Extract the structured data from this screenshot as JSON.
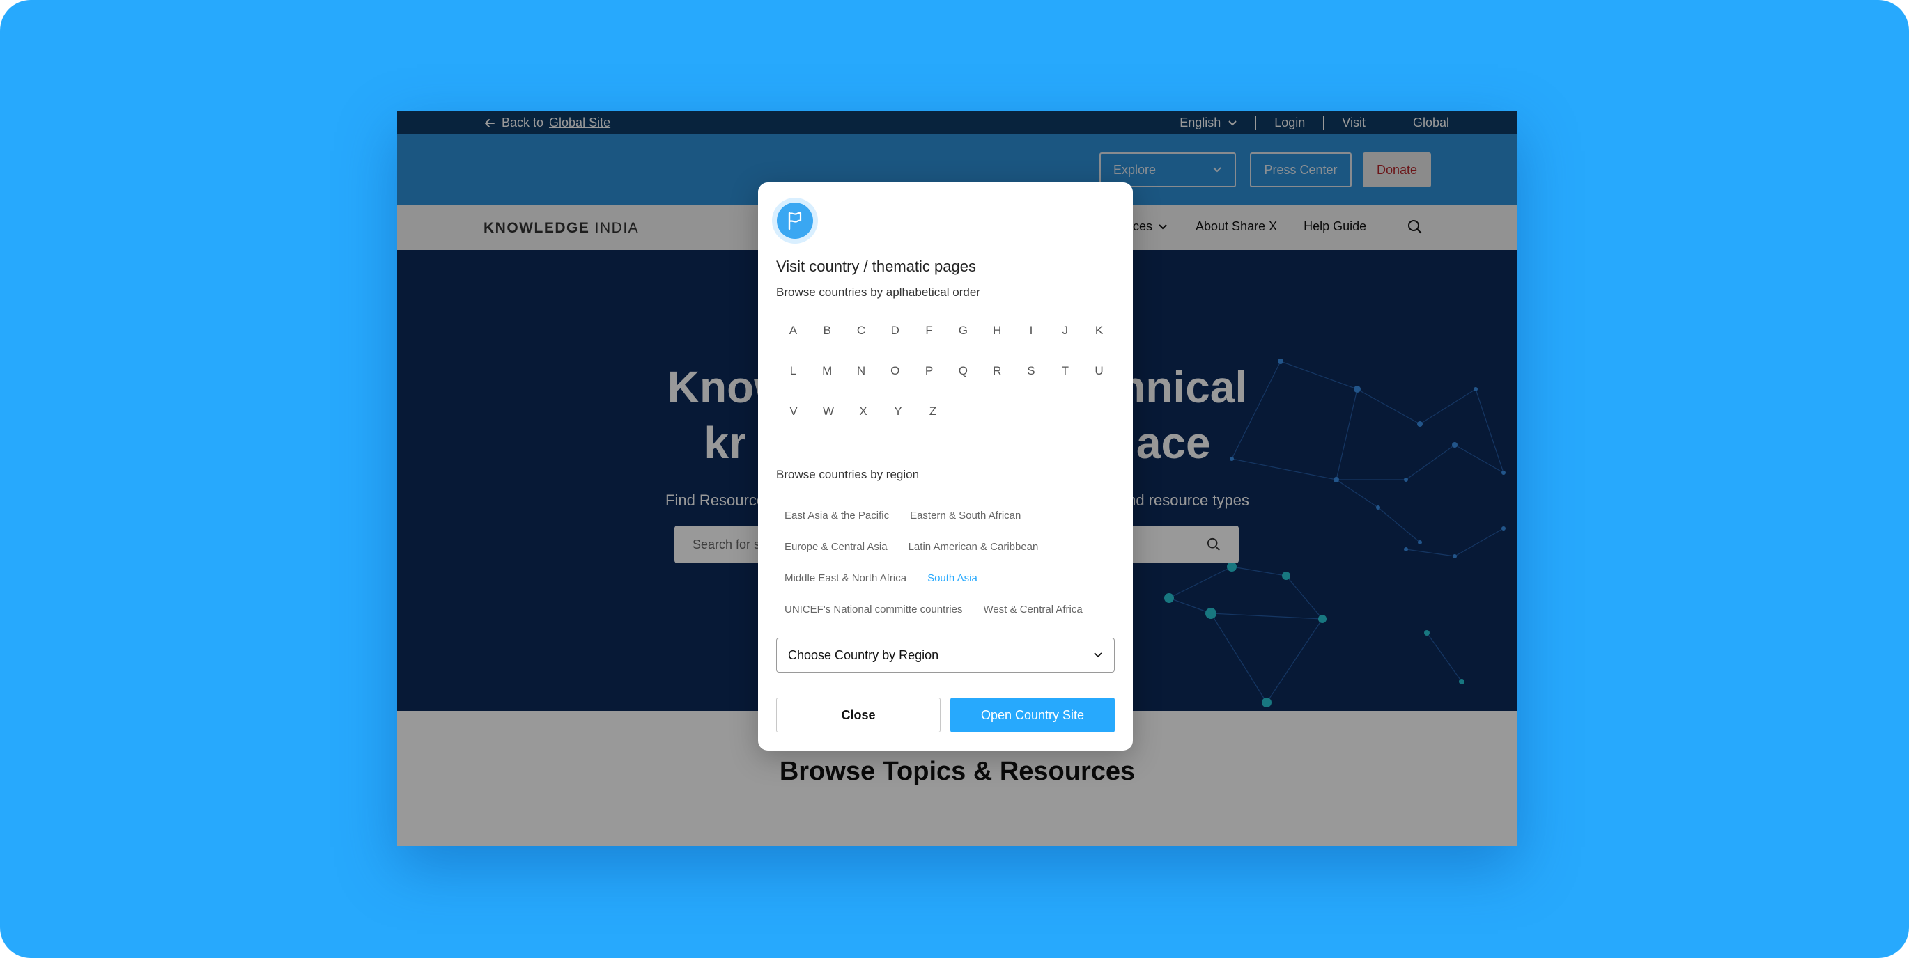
{
  "colors": {
    "frame_background": "#27a9fd",
    "top_bar": "#0e3b66",
    "header_bar": "#2e90d8",
    "hero_background": "#0d2a5b",
    "accent": "#27a9fd",
    "donate_text": "#b3262a"
  },
  "topbar": {
    "back_prefix": "Back to",
    "back_link": "Global Site",
    "language": "English",
    "login": "Login",
    "visit": "Visit",
    "global": "Global"
  },
  "header": {
    "explore_placeholder": "Explore",
    "press_center": "Press Center",
    "donate": "Donate"
  },
  "nav": {
    "brand_bold": "KNOWLEDGE",
    "brand_light": "INDIA",
    "resources_partial": "urces",
    "about": "About Share X",
    "help": "Help Guide"
  },
  "hero": {
    "line1_left": "Knowl",
    "line1_right": "chnical",
    "line2_left": "kr",
    "line2_right": "ace",
    "subtitle_left": "Find Resource",
    "subtitle_right": "nd resource types",
    "search_placeholder_partial": "Search for s"
  },
  "browse": {
    "heading": "Browse Topics & Resources"
  },
  "modal": {
    "icon": "flag-icon",
    "title": "Visit country / thematic pages",
    "alpha_title": "Browse countries by aplhabetical order",
    "letter_rows": [
      [
        "A",
        "B",
        "C",
        "D",
        "F",
        "G",
        "H",
        "I",
        "J",
        "K"
      ],
      [
        "L",
        "M",
        "N",
        "O",
        "P",
        "Q",
        "R",
        "S",
        "T",
        "U"
      ],
      [
        "V",
        "W",
        "X",
        "Y",
        "Z"
      ]
    ],
    "region_title": "Browse countries by region",
    "region_rows": [
      [
        "East Asia & the Pacific",
        "Eastern & South African"
      ],
      [
        "Europe & Central Asia",
        "Latin American & Caribbean"
      ],
      [
        "Middle East & North Africa",
        "South  Asia"
      ],
      [
        "UNICEF's National committe countries",
        "West & Central Africa"
      ]
    ],
    "active_region": "South  Asia",
    "select_label": "Choose Country by Region",
    "close_label": "Close",
    "open_label": "Open Country Site"
  }
}
